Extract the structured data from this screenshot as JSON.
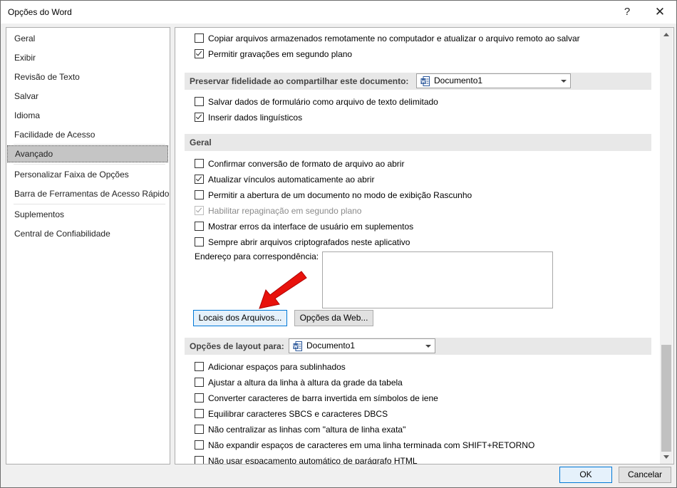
{
  "window": {
    "title": "Opções do Word",
    "help": "?",
    "close": "✕"
  },
  "nav": {
    "items": [
      {
        "label": "Geral"
      },
      {
        "label": "Exibir"
      },
      {
        "label": "Revisão de Texto"
      },
      {
        "label": "Salvar"
      },
      {
        "label": "Idioma"
      },
      {
        "label": "Facilidade de Acesso"
      },
      {
        "label": "Avançado",
        "active": true
      },
      {
        "label": "Personalizar Faixa de Opções"
      },
      {
        "label": "Barra de Ferramentas de Acesso Rápido"
      },
      {
        "label": "Suplementos"
      },
      {
        "label": "Central de Confiabilidade"
      }
    ]
  },
  "save": {
    "copy_remote": {
      "label": "Copiar arquivos armazenados remotamente no computador e atualizar o arquivo remoto ao salvar",
      "checked": false
    },
    "background_save": {
      "label": "Permitir gravações em segundo plano",
      "checked": true
    }
  },
  "fidelity": {
    "header": "Preservar fidelidade ao compartilhar este documento:",
    "document": "Documento1",
    "save_form_data": {
      "label": "Salvar dados de formulário como arquivo de texto delimitado",
      "checked": false
    },
    "linguistic_data": {
      "label": "Inserir dados linguísticos",
      "checked": true
    }
  },
  "general": {
    "header": "Geral",
    "confirm_conversion": {
      "label": "Confirmar conversão de formato de arquivo ao abrir",
      "checked": false
    },
    "update_links": {
      "label": "Atualizar vínculos automaticamente ao abrir",
      "checked": true
    },
    "draft_view": {
      "label": "Permitir a abertura de um documento no modo de exibição Rascunho",
      "checked": false
    },
    "background_repagination": {
      "label": "Habilitar repaginação em segundo plano",
      "checked": true,
      "disabled": true
    },
    "addin_errors": {
      "label": "Mostrar erros da interface de usuário em suplementos",
      "checked": false
    },
    "encrypted_files": {
      "label": "Sempre abrir arquivos criptografados neste aplicativo",
      "checked": false
    },
    "mailing_address_label": "Endereço para correspondência:",
    "mailing_address_value": "",
    "file_locations_button": "Locais dos Arquivos...",
    "web_options_button": "Opções da Web..."
  },
  "layout": {
    "header": "Opções de layout para:",
    "document": "Documento1",
    "options": [
      {
        "label": "Adicionar espaços para sublinhados",
        "checked": false
      },
      {
        "label": "Ajustar a altura da linha à altura da grade da tabela",
        "checked": false
      },
      {
        "label": "Converter caracteres de barra invertida em símbolos de iene",
        "checked": false
      },
      {
        "label": "Equilibrar caracteres SBCS e caracteres DBCS",
        "checked": false
      },
      {
        "label": "Não centralizar as linhas com \"altura de linha exata\"",
        "checked": false
      },
      {
        "label": "Não expandir espaços de caracteres em uma linha terminada com SHIFT+RETORNO",
        "checked": false
      },
      {
        "label": "Não usar espaçamento automático de parágrafo HTML",
        "checked": false
      }
    ]
  },
  "footer": {
    "ok": "OK",
    "cancel": "Cancelar"
  },
  "annotation": {
    "arrow_color": "#e8120c"
  },
  "icons": {
    "document_icon": "word-document-icon"
  }
}
